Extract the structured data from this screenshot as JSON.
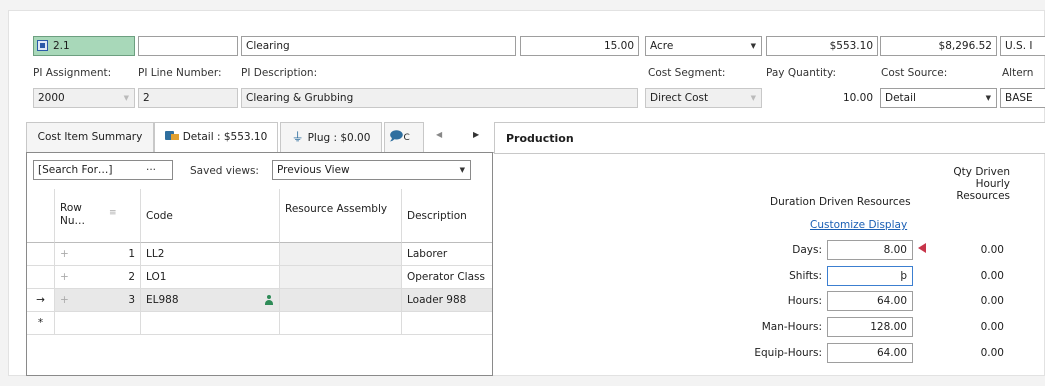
{
  "top_row": {
    "item_code": "2.1",
    "line_blank": "",
    "description": "Clearing",
    "quantity": "15.00",
    "unit": "Acre",
    "unit_price": "$553.10",
    "total": "$8,296.52",
    "currency": "U.S. I"
  },
  "labels": {
    "pi_assignment": "PI Assignment:",
    "pi_line_number": "PI Line Number:",
    "pi_description": "PI Description:",
    "cost_segment": "Cost Segment:",
    "pay_quantity": "Pay Quantity:",
    "cost_source": "Cost Source:",
    "alternate": "Altern"
  },
  "second_row": {
    "pi_assignment": "2000",
    "pi_line_number": "2",
    "pi_description": "Clearing & Grubbing",
    "cost_segment": "Direct Cost",
    "pay_quantity": "10.00",
    "cost_source": "Detail",
    "alternate": "BASE"
  },
  "tabs": [
    {
      "label": "Cost Item Summary"
    },
    {
      "label": "Detail : $553.10"
    },
    {
      "label": "Plug : $0.00"
    },
    {
      "label": "C"
    }
  ],
  "production_title": "Production",
  "toolbar": {
    "search": "[Search For…]",
    "ellipsis": "···",
    "saved_views_label": "Saved views:",
    "saved_view_value": "Previous View"
  },
  "grid": {
    "headers": {
      "row_num": "Row Nu…",
      "code": "Code",
      "resource_assembly": "Resource Assembly",
      "description": "Description"
    },
    "rows": [
      {
        "num": "1",
        "code": "LL2",
        "assembly": "",
        "description": "Laborer"
      },
      {
        "num": "2",
        "code": "LO1",
        "assembly": "",
        "description": "Operator Class"
      },
      {
        "num": "3",
        "code": "EL988",
        "assembly": "",
        "description": "Loader 988"
      }
    ],
    "current_marker": "→",
    "new_row_marker": "*"
  },
  "production": {
    "col_header_duration": "Duration Driven Resources",
    "col_header_qty": "Qty Driven Hourly Resources",
    "customize_link": "Customize Display",
    "rows": [
      {
        "label": "Days:",
        "value": "8.00",
        "qty": "0.00"
      },
      {
        "label": "Shifts:",
        "value": "þ",
        "qty": "0.00"
      },
      {
        "label": "Hours:",
        "value": "64.00",
        "qty": "0.00"
      },
      {
        "label": "Man-Hours:",
        "value": "128.00",
        "qty": "0.00"
      },
      {
        "label": "Equip-Hours:",
        "value": "64.00",
        "qty": "0.00"
      }
    ]
  },
  "colors": {
    "accent_green": "#a8d8b9",
    "link_blue": "#1a5fb4",
    "warning_red": "#c7354a"
  }
}
